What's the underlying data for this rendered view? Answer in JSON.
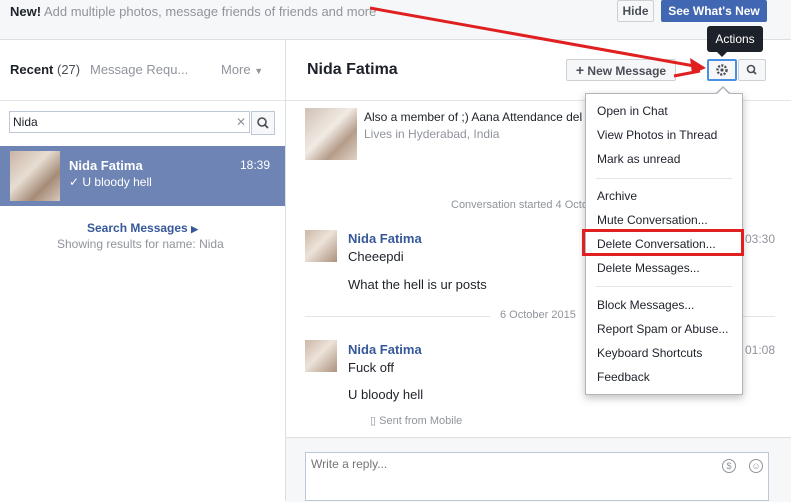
{
  "banner": {
    "new_label": "New!",
    "text": "Add multiple photos, message friends of friends and more",
    "hide_label": "Hide",
    "whats_new_label": "See What's New"
  },
  "left": {
    "recent_label": "Recent",
    "recent_count": "(27)",
    "requests_label": "Message Requ...",
    "more_label": "More",
    "search_value": "Nida",
    "thread": {
      "name": "Nida Fatima",
      "time": "18:39",
      "snippet": "U bloody hell"
    },
    "search_messages_label": "Search Messages",
    "showing_results": "Showing results for name: Nida"
  },
  "conversation": {
    "title": "Nida Fatima",
    "new_message_label": "New Message",
    "tooltip": "Actions",
    "member_text": "Also a member of ;) Aana Attendance del",
    "lives_text": "Lives in Hyderabad, India",
    "started_text": "Conversation started 4 Octo",
    "messages1": {
      "name": "Nida Fatima",
      "time": "03:30",
      "line1": "Cheeepdi",
      "line2": "What the hell is ur posts"
    },
    "date_divider": "6 October 2015",
    "messages2": {
      "name": "Nida Fatima",
      "time": "01:08",
      "line1": "Fuck off",
      "line2": "U bloody hell"
    },
    "sent_from": "Sent from Mobile",
    "reply_placeholder": "Write a reply..."
  },
  "menu": {
    "items": [
      "Open in Chat",
      "View Photos in Thread",
      "Mark as unread",
      "Archive",
      "Mute Conversation...",
      "Delete Conversation...",
      "Delete Messages...",
      "Block Messages...",
      "Report Spam or Abuse...",
      "Keyboard Shortcuts",
      "Feedback"
    ]
  },
  "colors": {
    "accent": "#4267b2",
    "selected_thread": "#6d84b4",
    "link": "#365899",
    "highlight": "#e02020"
  }
}
